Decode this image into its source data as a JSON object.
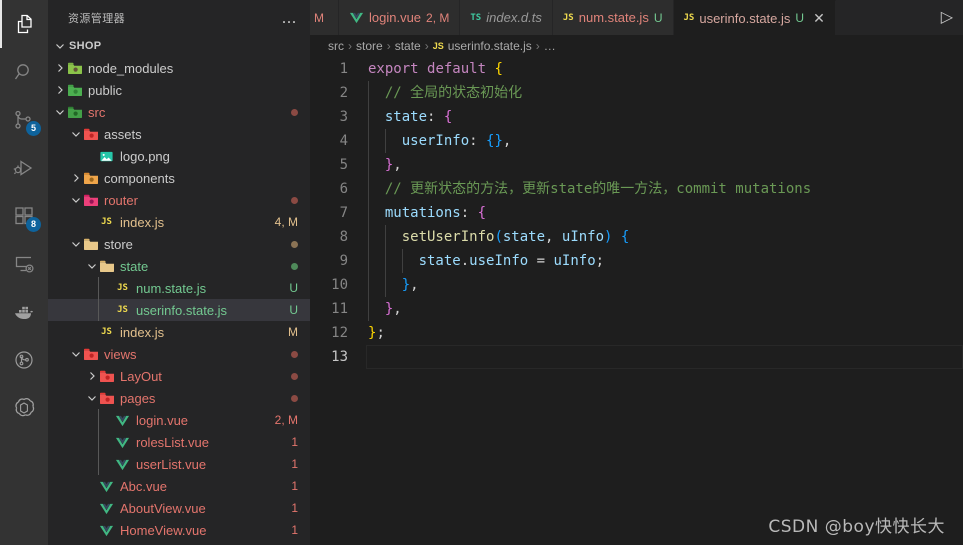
{
  "activity_bar": {
    "items": [
      {
        "name": "explorer",
        "icon": "files-icon",
        "active": true,
        "badge": null
      },
      {
        "name": "search",
        "icon": "search-icon",
        "active": false,
        "badge": null
      },
      {
        "name": "source-control",
        "icon": "source-control-icon",
        "active": false,
        "badge": "5"
      },
      {
        "name": "run-and-debug",
        "icon": "run-debug-icon",
        "active": false,
        "badge": null
      },
      {
        "name": "extensions",
        "icon": "extensions-icon",
        "active": false,
        "badge": "8"
      },
      {
        "name": "remote-explorer",
        "icon": "remote-explorer-icon",
        "active": false,
        "badge": null
      },
      {
        "name": "docker",
        "icon": "docker-whale-icon",
        "active": false,
        "badge": null
      },
      {
        "name": "gitlens",
        "icon": "gitlens-icon",
        "active": false,
        "badge": null
      },
      {
        "name": "chatgpt",
        "icon": "chatgpt-icon",
        "active": false,
        "badge": null
      }
    ]
  },
  "sidebar": {
    "title": "资源管理器",
    "more_actions": "…",
    "root_label": "SHOP",
    "tree": [
      {
        "label": "node_modules",
        "depth": 1,
        "twisty": "collapsed",
        "icon": "folder-node-modules",
        "color": "c-default",
        "deco": "",
        "deco_color": ""
      },
      {
        "label": "public",
        "depth": 1,
        "twisty": "collapsed",
        "icon": "folder-public",
        "color": "c-default",
        "deco": "",
        "deco_color": ""
      },
      {
        "label": "src",
        "depth": 1,
        "twisty": "expanded",
        "icon": "folder-src",
        "color": "c-modred",
        "deco": "dot",
        "deco_color": "#8b4a43"
      },
      {
        "label": "assets",
        "depth": 2,
        "twisty": "expanded",
        "icon": "folder-assets",
        "color": "c-default",
        "deco": "",
        "deco_color": ""
      },
      {
        "label": "logo.png",
        "depth": 3,
        "twisty": "none",
        "icon": "image-file-icon",
        "color": "c-default",
        "deco": "",
        "deco_color": ""
      },
      {
        "label": "components",
        "depth": 2,
        "twisty": "collapsed",
        "icon": "folder-components",
        "color": "c-default",
        "deco": "",
        "deco_color": ""
      },
      {
        "label": "router",
        "depth": 2,
        "twisty": "expanded",
        "icon": "folder-router",
        "color": "c-modred",
        "deco": "dot",
        "deco_color": "#8b4a43"
      },
      {
        "label": "index.js",
        "depth": 3,
        "twisty": "none",
        "icon": "js-file-icon",
        "color": "c-mod",
        "deco": "4, M",
        "deco_color": "#e2c08d"
      },
      {
        "label": "store",
        "depth": 2,
        "twisty": "expanded",
        "icon": "folder-store",
        "color": "c-default",
        "deco": "dot",
        "deco_color": "#8b7355"
      },
      {
        "label": "state",
        "depth": 3,
        "twisty": "expanded",
        "icon": "folder-state",
        "color": "c-untracked",
        "deco": "dot",
        "deco_color": "#4f8a5a"
      },
      {
        "label": "num.state.js",
        "depth": 4,
        "twisty": "none",
        "icon": "js-file-icon",
        "color": "c-untracked",
        "deco": "U",
        "deco_color": "#73c991"
      },
      {
        "label": "userinfo.state.js",
        "depth": 4,
        "twisty": "none",
        "icon": "js-file-icon",
        "color": "c-untracked",
        "deco": "U",
        "deco_color": "#73c991",
        "selected": true
      },
      {
        "label": "index.js",
        "depth": 3,
        "twisty": "none",
        "icon": "js-file-icon",
        "color": "c-mod",
        "deco": "M",
        "deco_color": "#e2c08d"
      },
      {
        "label": "views",
        "depth": 2,
        "twisty": "expanded",
        "icon": "folder-views",
        "color": "c-modred",
        "deco": "dot",
        "deco_color": "#8b4a43"
      },
      {
        "label": "LayOut",
        "depth": 3,
        "twisty": "collapsed",
        "icon": "folder-layout",
        "color": "c-modred",
        "deco": "dot",
        "deco_color": "#8b4a43"
      },
      {
        "label": "pages",
        "depth": 3,
        "twisty": "expanded",
        "icon": "folder-pages",
        "color": "c-modred",
        "deco": "dot",
        "deco_color": "#8b4a43"
      },
      {
        "label": "login.vue",
        "depth": 4,
        "twisty": "none",
        "icon": "vue-file-icon",
        "color": "c-modred",
        "deco": "2, M",
        "deco_color": "#e4756d"
      },
      {
        "label": "rolesList.vue",
        "depth": 4,
        "twisty": "none",
        "icon": "vue-file-icon",
        "color": "c-modred",
        "deco": "1",
        "deco_color": "#e4756d"
      },
      {
        "label": "userList.vue",
        "depth": 4,
        "twisty": "none",
        "icon": "vue-file-icon",
        "color": "c-modred",
        "deco": "1",
        "deco_color": "#e4756d"
      },
      {
        "label": "Abc.vue",
        "depth": 3,
        "twisty": "none",
        "icon": "vue-file-icon",
        "color": "c-modred",
        "deco": "1",
        "deco_color": "#e4756d"
      },
      {
        "label": "AboutView.vue",
        "depth": 3,
        "twisty": "none",
        "icon": "vue-file-icon",
        "color": "c-modred",
        "deco": "1",
        "deco_color": "#e4756d"
      },
      {
        "label": "HomeView.vue",
        "depth": 3,
        "twisty": "none",
        "icon": "vue-file-icon",
        "color": "c-modred",
        "deco": "1",
        "deco_color": "#e4756d"
      }
    ]
  },
  "tabs": [
    {
      "name": "",
      "icon": "none",
      "deco": "M",
      "active": false,
      "partial": true,
      "italic": false,
      "close": false
    },
    {
      "name": "login.vue",
      "icon": "vue-file-icon",
      "deco": "2, M",
      "active": false,
      "partial": false,
      "italic": false,
      "close": false
    },
    {
      "name": "index.d.ts",
      "icon": "ts-file-icon",
      "deco": "",
      "active": false,
      "partial": false,
      "italic": true,
      "close": false
    },
    {
      "name": "num.state.js",
      "icon": "js-file-icon",
      "deco": "U",
      "active": false,
      "partial": false,
      "italic": false,
      "close": false
    },
    {
      "name": "userinfo.state.js",
      "icon": "js-file-icon",
      "deco": "U",
      "active": true,
      "partial": false,
      "italic": false,
      "close": true,
      "close_label": "✕"
    }
  ],
  "tab_actions": {
    "run_label": "▷"
  },
  "breadcrumb": {
    "segments": [
      "src",
      "store",
      "state",
      "userinfo.state.js",
      "…"
    ],
    "separator": "›",
    "file_icon_text": "JS"
  },
  "code": {
    "line_numbers": [
      "1",
      "2",
      "3",
      "4",
      "5",
      "6",
      "7",
      "8",
      "9",
      "10",
      "11",
      "12",
      "13"
    ],
    "lines": [
      {
        "n": "1",
        "tokens": [
          {
            "t": "export",
            "c": "t-kw"
          },
          {
            "t": " ",
            "c": "t-plain"
          },
          {
            "t": "default",
            "c": "t-kw"
          },
          {
            "t": " ",
            "c": "t-plain"
          },
          {
            "t": "{",
            "c": "t-b1"
          }
        ],
        "indent": 0
      },
      {
        "n": "2",
        "tokens": [
          {
            "t": "  ",
            "c": "t-plain"
          },
          {
            "t": "// 全局的状态初始化",
            "c": "t-cmt"
          }
        ],
        "indent": 1
      },
      {
        "n": "3",
        "tokens": [
          {
            "t": "  ",
            "c": "t-plain"
          },
          {
            "t": "state",
            "c": "t-prop"
          },
          {
            "t": ":",
            "c": "t-plain"
          },
          {
            "t": " ",
            "c": "t-plain"
          },
          {
            "t": "{",
            "c": "t-b2"
          }
        ],
        "indent": 1
      },
      {
        "n": "4",
        "tokens": [
          {
            "t": "    ",
            "c": "t-plain"
          },
          {
            "t": "userInfo",
            "c": "t-prop"
          },
          {
            "t": ":",
            "c": "t-plain"
          },
          {
            "t": " ",
            "c": "t-plain"
          },
          {
            "t": "{}",
            "c": "t-b3"
          },
          {
            "t": ",",
            "c": "t-plain"
          }
        ],
        "indent": 2
      },
      {
        "n": "5",
        "tokens": [
          {
            "t": "  ",
            "c": "t-plain"
          },
          {
            "t": "}",
            "c": "t-b2"
          },
          {
            "t": ",",
            "c": "t-plain"
          }
        ],
        "indent": 1
      },
      {
        "n": "6",
        "tokens": [
          {
            "t": "  ",
            "c": "t-plain"
          },
          {
            "t": "// 更新状态的方法，更新state的唯一方法，commit mutations",
            "c": "t-cmt"
          }
        ],
        "indent": 1
      },
      {
        "n": "7",
        "tokens": [
          {
            "t": "  ",
            "c": "t-plain"
          },
          {
            "t": "mutations",
            "c": "t-prop"
          },
          {
            "t": ":",
            "c": "t-plain"
          },
          {
            "t": " ",
            "c": "t-plain"
          },
          {
            "t": "{",
            "c": "t-b2"
          }
        ],
        "indent": 1
      },
      {
        "n": "8",
        "tokens": [
          {
            "t": "    ",
            "c": "t-plain"
          },
          {
            "t": "setUserInfo",
            "c": "t-fn"
          },
          {
            "t": "(",
            "c": "t-b3"
          },
          {
            "t": "state",
            "c": "t-var"
          },
          {
            "t": ", ",
            "c": "t-plain"
          },
          {
            "t": "uInfo",
            "c": "t-var"
          },
          {
            "t": ")",
            "c": "t-b3"
          },
          {
            "t": " ",
            "c": "t-plain"
          },
          {
            "t": "{",
            "c": "t-b3"
          }
        ],
        "indent": 2
      },
      {
        "n": "9",
        "tokens": [
          {
            "t": "      ",
            "c": "t-plain"
          },
          {
            "t": "state",
            "c": "t-var"
          },
          {
            "t": ".",
            "c": "t-plain"
          },
          {
            "t": "useInfo",
            "c": "t-prop"
          },
          {
            "t": " = ",
            "c": "t-plain"
          },
          {
            "t": "uInfo",
            "c": "t-var"
          },
          {
            "t": ";",
            "c": "t-plain"
          }
        ],
        "indent": 3
      },
      {
        "n": "10",
        "tokens": [
          {
            "t": "    ",
            "c": "t-plain"
          },
          {
            "t": "}",
            "c": "t-b3"
          },
          {
            "t": ",",
            "c": "t-plain"
          }
        ],
        "indent": 2
      },
      {
        "n": "11",
        "tokens": [
          {
            "t": "  ",
            "c": "t-plain"
          },
          {
            "t": "}",
            "c": "t-b2"
          },
          {
            "t": ",",
            "c": "t-plain"
          }
        ],
        "indent": 1
      },
      {
        "n": "12",
        "tokens": [
          {
            "t": "}",
            "c": "t-b1"
          },
          {
            "t": ";",
            "c": "t-plain"
          }
        ],
        "indent": 0
      },
      {
        "n": "13",
        "tokens": [],
        "indent": 0,
        "cursor": true
      }
    ]
  },
  "watermark": {
    "text": "CSDN @boy快快长大"
  },
  "colors": {
    "activity_bar_bg": "#333333",
    "sidebar_bg": "#252526",
    "editor_bg": "#1e1e1e",
    "tab_inactive_bg": "#2d2d2d",
    "selection_bg": "#37373d",
    "badge_bg": "#0e639c",
    "git_modified": "#e2c08d",
    "git_untracked": "#73c991",
    "comment": "#6a9955",
    "keyword": "#c586c0",
    "property": "#9cdcfe",
    "function": "#dcdcaa"
  }
}
